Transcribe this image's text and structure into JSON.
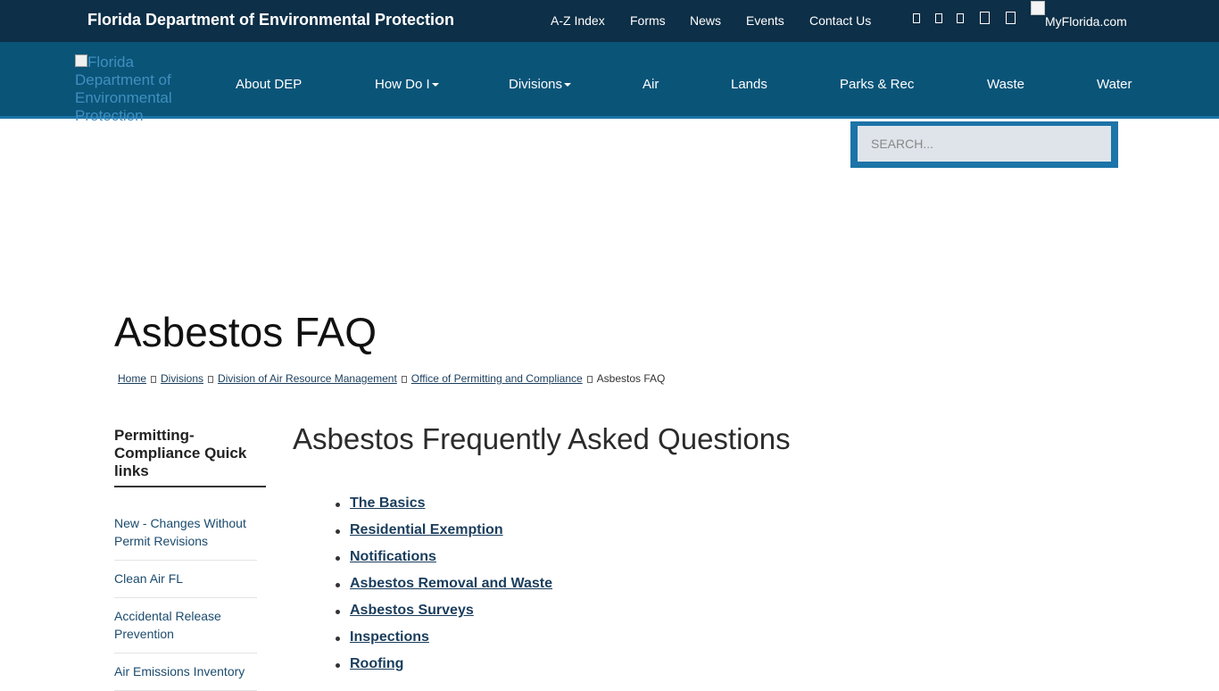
{
  "topbar": {
    "agency_title": "Florida Department of Environmental Protection",
    "links": [
      "A-Z Index",
      "Forms",
      "News",
      "Events",
      "Contact Us"
    ],
    "myflorida_alt": "MyFlorida.com"
  },
  "nav": {
    "logo_alt": "Florida Department of Environmental Protection",
    "items": [
      "About DEP",
      "How Do I",
      "Divisions",
      "Air",
      "Lands",
      "Parks & Rec",
      "Waste",
      "Water"
    ]
  },
  "search": {
    "placeholder": "SEARCH..."
  },
  "page": {
    "title": "Asbestos FAQ",
    "breadcrumb": [
      "Home",
      "Divisions",
      "Division of Air Resource Management",
      "Office of Permitting and Compliance"
    ],
    "breadcrumb_current": "Asbestos FAQ"
  },
  "sidebar": {
    "heading": "Permitting-Compliance Quick links",
    "items": [
      "New - Changes Without Permit Revisions",
      "Clean Air FL",
      "Accidental Release Prevention",
      "Air Emissions Inventory"
    ]
  },
  "main": {
    "heading": "Asbestos Frequently Asked Questions",
    "faq_links": [
      "The Basics",
      "Residential Exemption",
      "Notifications",
      "Asbestos Removal and Waste",
      "Asbestos Surveys",
      "Inspections",
      "Roofing"
    ]
  },
  "colors": {
    "topbar_bg": "#0d2f47",
    "nav_bg": "#0a5478",
    "accent": "#1c74a8",
    "link": "#1a3d5c"
  },
  "icons": [
    "facebook-icon",
    "twitter-icon",
    "instagram-icon",
    "youtube-icon",
    "rss-icon"
  ]
}
